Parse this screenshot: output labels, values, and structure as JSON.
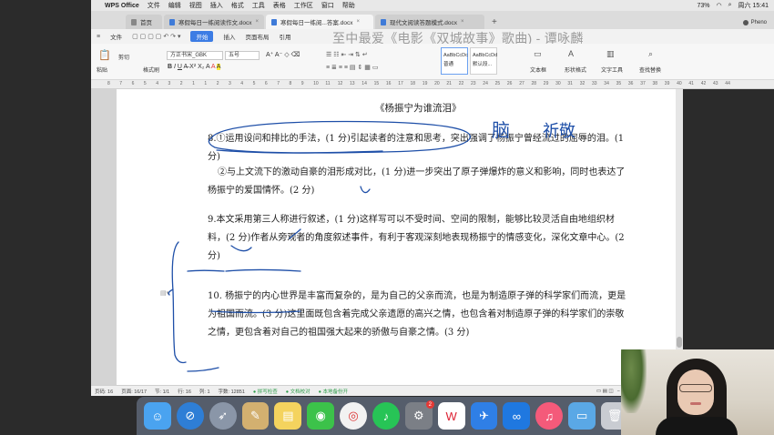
{
  "menubar": {
    "app_name": "WPS Office",
    "items": [
      "文件",
      "编辑",
      "视图",
      "插入",
      "格式",
      "工具",
      "表格",
      "工作区",
      "窗口",
      "帮助"
    ],
    "battery": "73%",
    "clock": "周六 15:41"
  },
  "tabs": {
    "home": "首页",
    "items": [
      {
        "label": "寒假每日一练阅读作文.docx"
      },
      {
        "label": "寒假每日一练阅...答案.docx"
      },
      {
        "label": "现代文阅读答题模式.docx"
      }
    ],
    "user": "Pheno"
  },
  "ribbon_menu": {
    "file": "文件",
    "items": [
      "开始",
      "插入",
      "页面布局",
      "引用"
    ]
  },
  "video_title": "至中最爱《电影《双城故事》歌曲) - 谭咏麟",
  "ribbon_tools": {
    "paste": "粘贴",
    "format_painter": "格式刷",
    "cut": "剪切",
    "font_name": "方正书宋_GBK",
    "font_size": "五号",
    "style1_sample": "AaBbCcDc",
    "style1_name": "普通",
    "style2_sample": "AaBbCcDd",
    "style2_name": "默认段...",
    "text_box": "文本框",
    "shape_format": "形状格式",
    "text_tools": "文字工具",
    "find_replace": "查找替换"
  },
  "document": {
    "title": "《杨振宁为谁流泪》",
    "p8a": "8.①运用设问和排比的手法，(1 分)引起读者的注意和思考，突出强调了杨振宁曾经流过的屈辱的泪。(1 分)",
    "p8b": "②与上文流下的激动自豪的泪形成对比，(1 分)进一步突出了原子弹爆炸的意义和影响，同时也表达了杨振宁的爱国情怀。(2 分)",
    "p9": "9.本文采用第三人称进行叙述，(1 分)这样写可以不受时间、空间的限制，能够比较灵活自由地组织材料，(2 分)作者从旁观者的角度叙述事件，有利于客观深刻地表现杨振宁的情感变化，深化文章中心。(2 分)",
    "p10": "10. 杨振宁的内心世界是丰富而复杂的，是为自己的父亲而流，也是为制造原子弹的科学家们而流，更是为祖国而流。(3 分)这里面既包含着完成父亲遗愿的高兴之情，也包含着对制造原子弹的科学家们的崇敬之情，更包含着对自己的祖国强大起来的骄傲与自豪之情。(3 分)"
  },
  "handwriting": {
    "word1": "脑",
    "word2": "祈敬"
  },
  "statusbar": {
    "page_num": "页码: 16",
    "page": "页面: 16/17",
    "section": "节: 1/1",
    "row": "行: 16",
    "col": "列: 1",
    "words": "字数: 12851",
    "spell": "拼写检查",
    "doc_check": "文档校对",
    "backup": "本地备份开"
  },
  "dock": {
    "items": [
      "finder",
      "launchpad",
      "rocket",
      "preview",
      "notes",
      "wechat",
      "chrome",
      "music-player",
      "settings",
      "wps",
      "feishu",
      "xmind",
      "itunes",
      "folder",
      "trash"
    ],
    "badge": "2"
  },
  "ruler": {
    "ticks": [
      "8",
      "7",
      "6",
      "5",
      "4",
      "3",
      "2",
      "1",
      "1",
      "2",
      "3",
      "4",
      "5",
      "6",
      "7",
      "8",
      "9",
      "10",
      "11",
      "12",
      "13",
      "14",
      "15",
      "16",
      "17",
      "18",
      "19",
      "20",
      "21",
      "22",
      "23",
      "24",
      "25",
      "26",
      "27",
      "28",
      "29",
      "30",
      "31",
      "32",
      "33",
      "34",
      "35",
      "36",
      "37",
      "38",
      "39",
      "40",
      "41",
      "42",
      "43",
      "44"
    ]
  }
}
